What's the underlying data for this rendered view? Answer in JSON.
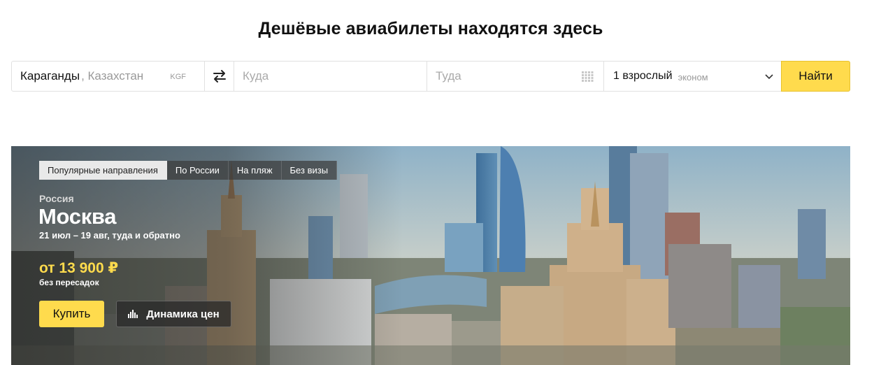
{
  "header": {
    "title": "Дешёвые авиабилеты находятся здесь"
  },
  "search": {
    "from_city": "Караганды",
    "from_country": ", Казахстан",
    "from_code": "KGF",
    "to_placeholder": "Куда",
    "date_placeholder": "Туда",
    "passengers": "1 взрослый",
    "class": "эконом",
    "find_label": "Найти",
    "icons": {
      "swap": "swap-arrows-icon",
      "calendar": "calendar-icon",
      "chevron": "chevron-down-icon"
    }
  },
  "promo": {
    "tabs": [
      {
        "label": "Популярные направления",
        "active": true
      },
      {
        "label": "По России",
        "active": false
      },
      {
        "label": "На пляж",
        "active": false
      },
      {
        "label": "Без визы",
        "active": false
      }
    ],
    "country": "Россия",
    "city": "Москва",
    "dates": "21 июл – 19 авг, туда и обратно",
    "price": "от 13 900 ₽",
    "transfers": "без пересадок",
    "buy_label": "Купить",
    "dynamics_label": "Динамика цен",
    "icons": {
      "dynamics": "bar-chart-icon"
    }
  },
  "colors": {
    "accent": "#ffdb4d",
    "price": "#ffdb4d",
    "border": "#e1e1e1"
  }
}
